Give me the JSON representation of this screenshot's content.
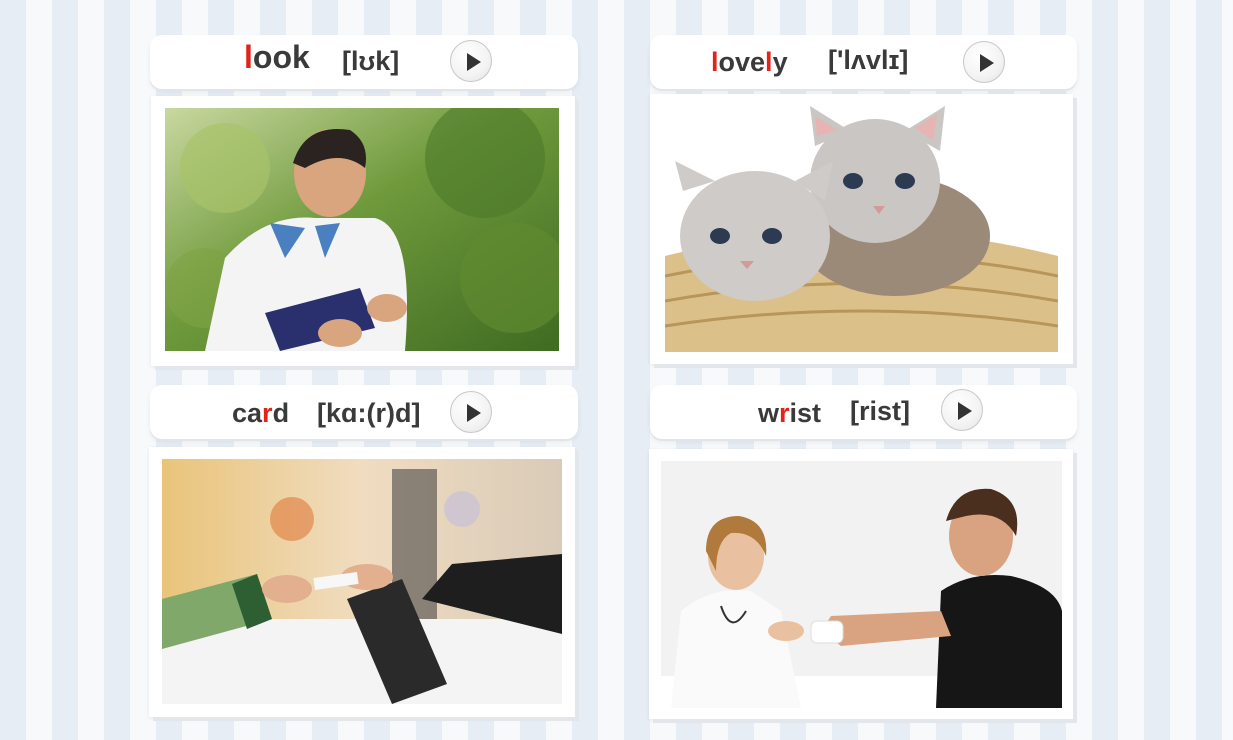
{
  "cards": [
    {
      "word_parts": [
        {
          "text": "l",
          "highlight": true
        },
        {
          "text": "ook",
          "highlight": false
        }
      ],
      "phonetic": "[lʊk]",
      "play_icon": "play-icon",
      "image": "man-reading-book-outdoors"
    },
    {
      "word_parts": [
        {
          "text": "l",
          "highlight": true
        },
        {
          "text": "ove",
          "highlight": false
        },
        {
          "text": "l",
          "highlight": true
        },
        {
          "text": "y",
          "highlight": false
        }
      ],
      "phonetic": "['lʌvlɪ]",
      "play_icon": "play-icon",
      "image": "kittens-in-basket"
    },
    {
      "word_parts": [
        {
          "text": "ca",
          "highlight": false
        },
        {
          "text": "r",
          "highlight": true
        },
        {
          "text": "d",
          "highlight": false
        }
      ],
      "phonetic": "[kɑ:(r)d]",
      "play_icon": "play-icon",
      "image": "hands-passing-card"
    },
    {
      "word_parts": [
        {
          "text": "w",
          "highlight": false
        },
        {
          "text": "r",
          "highlight": true
        },
        {
          "text": "ist",
          "highlight": false
        }
      ],
      "phonetic": "[rist]",
      "play_icon": "play-icon",
      "image": "doctor-bandaging-wrist"
    }
  ],
  "colors": {
    "highlight": "#e2231a",
    "text": "#3a3a3a",
    "stripe_dark": "#e7edf5",
    "stripe_light": "#f7f9fb"
  }
}
